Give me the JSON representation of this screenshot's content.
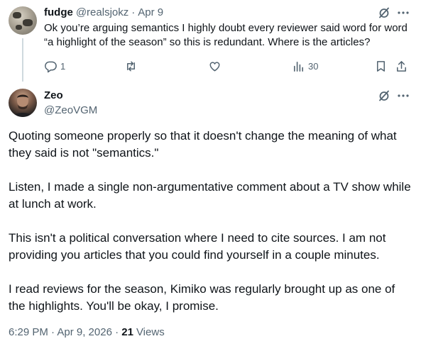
{
  "reply": {
    "author_name": "fudge",
    "author_handle": "@realsjokz",
    "separator": "·",
    "date": "Apr 9",
    "text": "Ok you’re arguing semantics I highly doubt every reviewer said word for word “a highlight of the season” so this is redundant. Where is the articles?",
    "actions": {
      "replies": "1",
      "reposts": "",
      "likes": "",
      "views": "30"
    }
  },
  "main_post": {
    "author_name": "Zeo",
    "author_handle": "@ZeoVGM",
    "paragraphs": [
      "Quoting someone properly so that it doesn't change the meaning of what they said is not \"semantics.\"",
      "Listen, I made a single non-argumentative comment about a TV show while at lunch at work.",
      "This isn't a political conversation where I need to cite sources. I am not providing you articles that you could find yourself in a couple minutes.",
      "I read reviews for the season, Kimiko was regularly brought up as one of the highlights. You'll be okay, I promise."
    ],
    "timestamp": "6:29 PM · Apr 9, 2026 · ",
    "view_count": "21",
    "views_label": "Views"
  },
  "colors": {
    "text_primary": "#0f1419",
    "text_secondary": "#536471",
    "thread_line": "#cfd9de"
  },
  "icons": [
    "grok-icon",
    "more-icon",
    "reply-icon",
    "repost-icon",
    "like-icon",
    "views-icon",
    "bookmark-icon",
    "share-icon"
  ]
}
